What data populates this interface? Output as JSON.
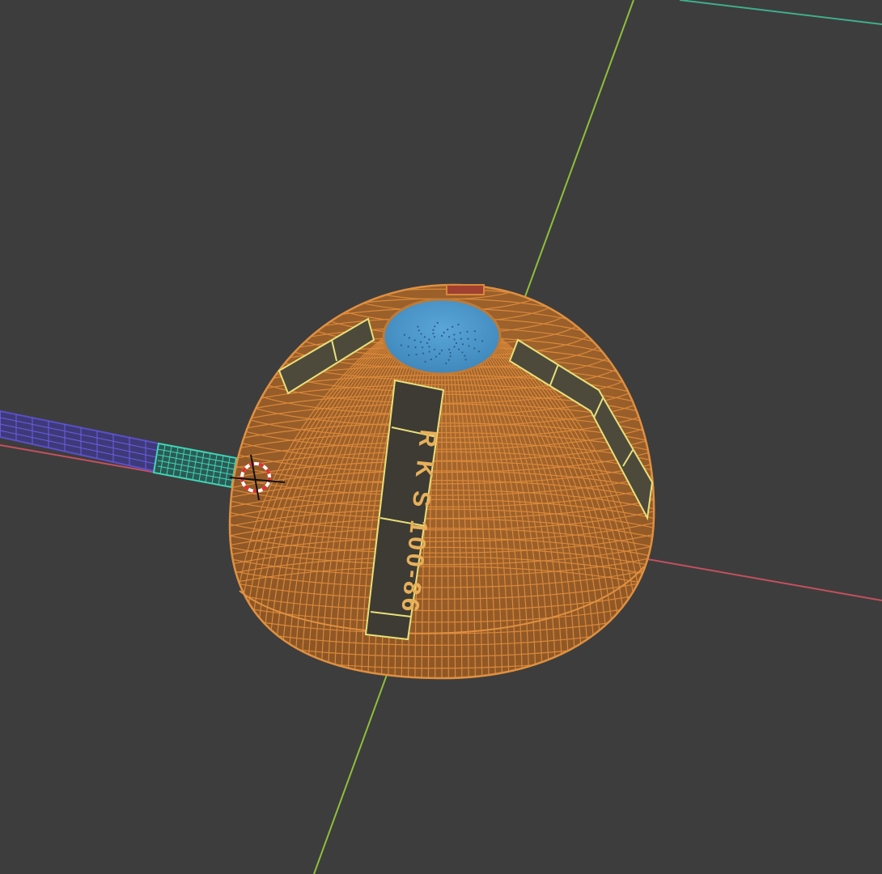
{
  "viewport": {
    "background": "#3d3d3d",
    "axes": {
      "x_color": "#c4505f",
      "y_color": "#8fbf3a"
    }
  },
  "model": {
    "dome_wire_color": "#d9883a",
    "dome_fill": "#b8773a",
    "cap_color": "#4e95c9",
    "panel_text": "R K S 100-86",
    "panel_highlight": "#e8e07a"
  },
  "pipe": {
    "outer_color": "#5a4fc8",
    "inner_color": "#3fd4b4"
  },
  "cursor": {
    "icon": "3d-cursor-icon"
  }
}
